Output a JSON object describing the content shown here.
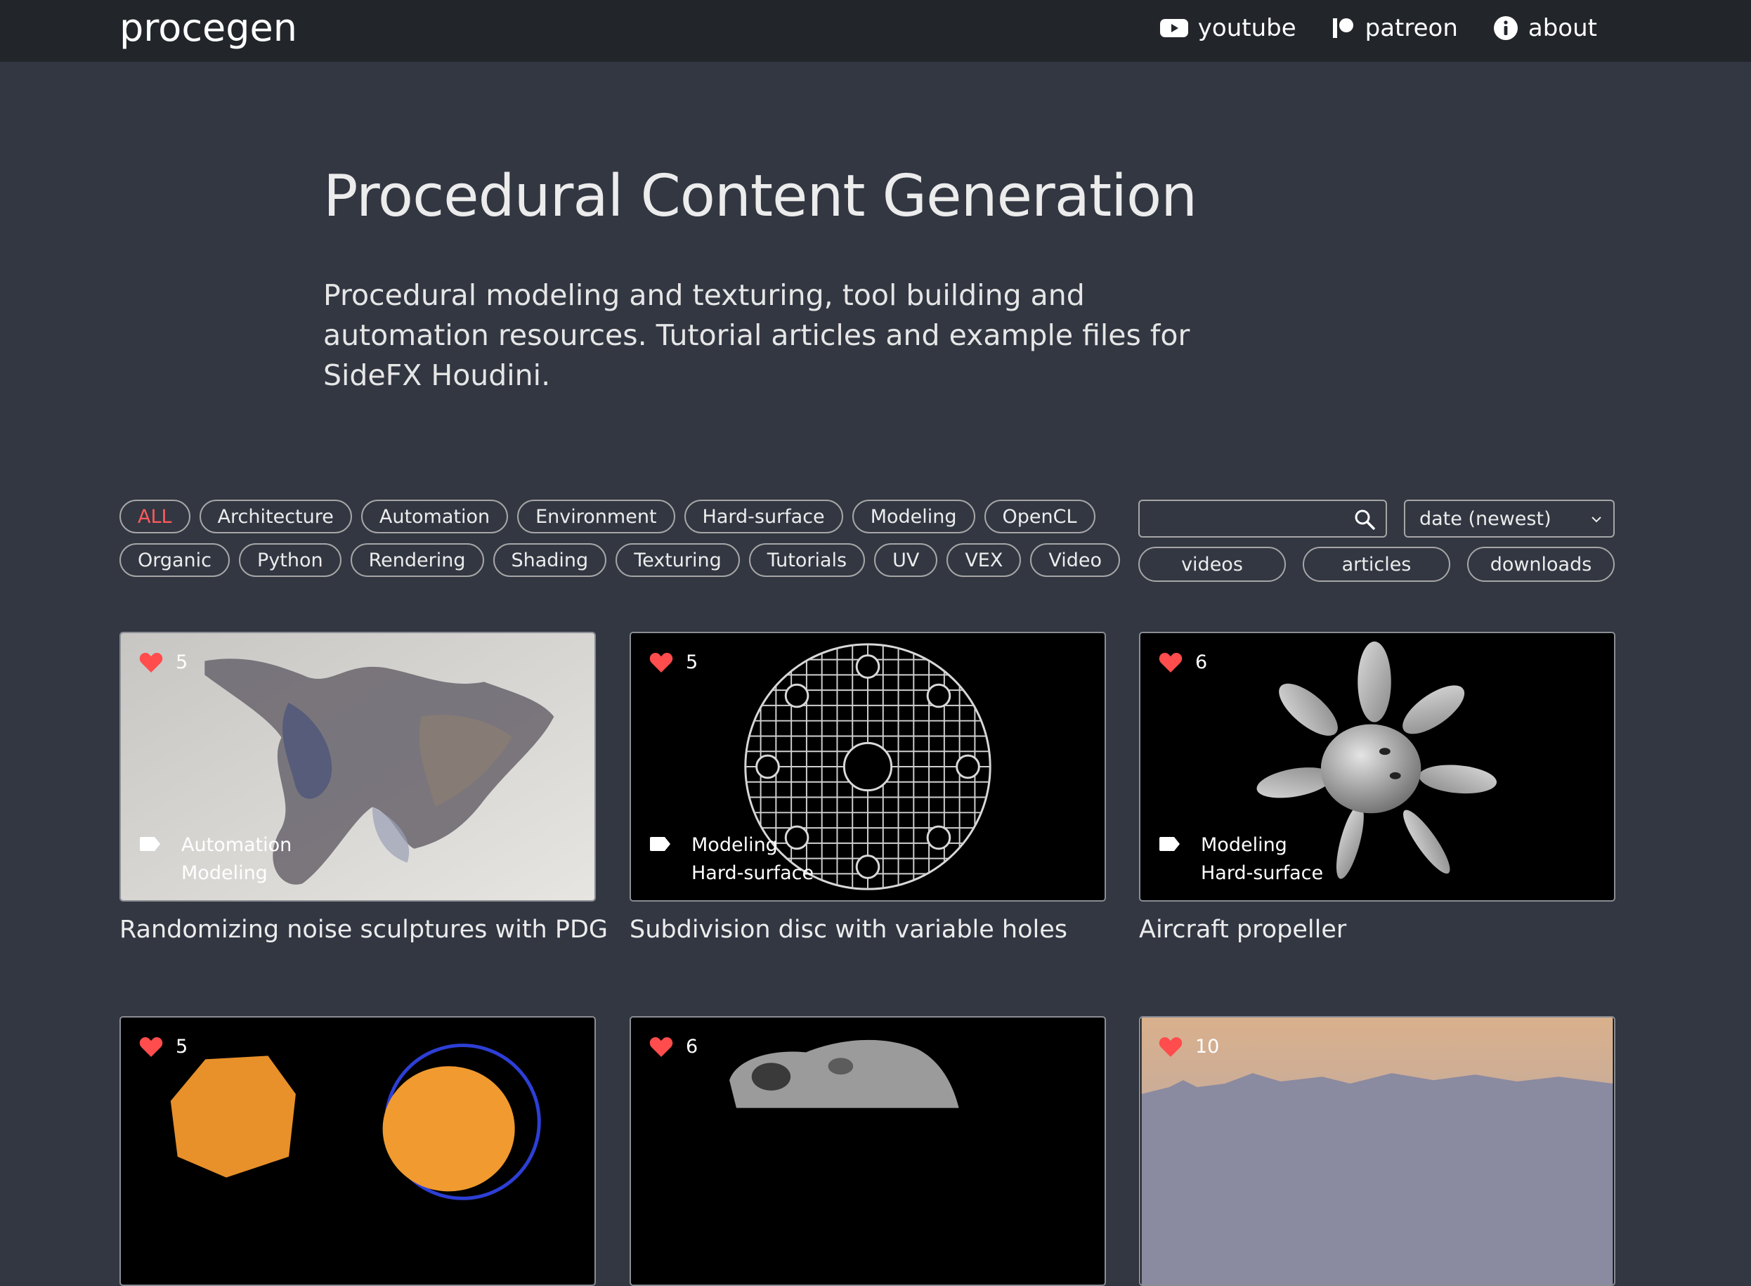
{
  "nav": {
    "logo": "procegen",
    "links": [
      {
        "label": "youtube",
        "icon": "youtube-icon"
      },
      {
        "label": "patreon",
        "icon": "patreon-icon"
      },
      {
        "label": "about",
        "icon": "info-icon"
      }
    ]
  },
  "hero": {
    "title": "Procedural Content Generation",
    "subtitle": "Procedural modeling and texturing, tool building and automation resources. Tutorial articles and example files for SideFX Houdini."
  },
  "filters": {
    "tag_rows": [
      [
        "ALL",
        "Architecture",
        "Automation",
        "Environment",
        "Hard-surface",
        "Modeling",
        "OpenCL"
      ],
      [
        "Organic",
        "Python",
        "Rendering",
        "Shading",
        "Texturing",
        "Tutorials",
        "UV",
        "VEX",
        "Video"
      ]
    ],
    "active_tag": "ALL",
    "search_value": "",
    "sort": "date (newest)",
    "types": [
      "videos",
      "articles",
      "downloads"
    ]
  },
  "colors": {
    "background": "#323742",
    "navbar": "#22252a",
    "accent": "#ff5a5a",
    "border": "#a6a6a6"
  },
  "cards": [
    {
      "title": "Randomizing noise sculptures with PDG",
      "likes": "5",
      "categories": [
        "Automation",
        "Modeling"
      ]
    },
    {
      "title": "Subdivision disc with variable holes",
      "likes": "5",
      "categories": [
        "Modeling",
        "Hard-surface"
      ]
    },
    {
      "title": "Aircraft propeller",
      "likes": "6",
      "categories": [
        "Modeling",
        "Hard-surface"
      ]
    },
    {
      "title": "",
      "likes": "5",
      "categories": []
    },
    {
      "title": "",
      "likes": "6",
      "categories": []
    },
    {
      "title": "",
      "likes": "10",
      "categories": []
    }
  ]
}
